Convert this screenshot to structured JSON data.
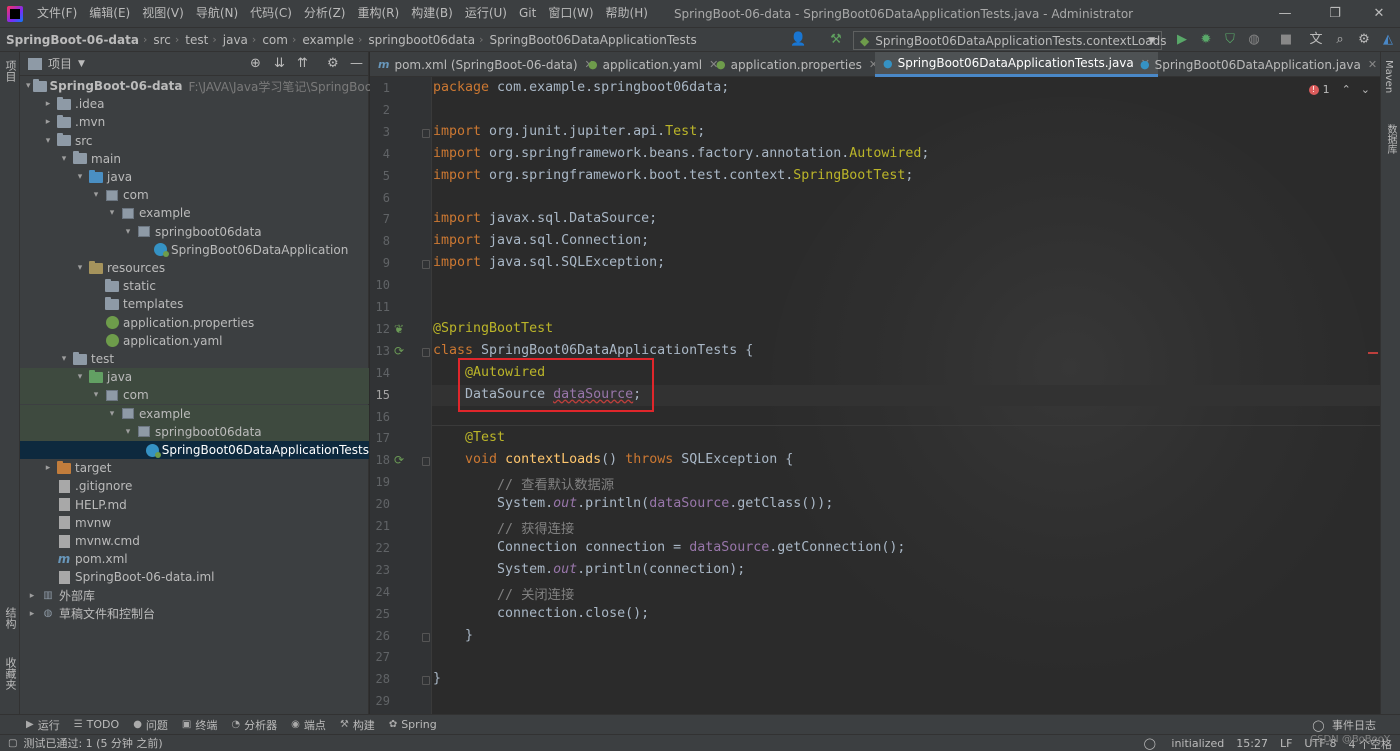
{
  "menubar": {
    "items": [
      "文件(F)",
      "编辑(E)",
      "视图(V)",
      "导航(N)",
      "代码(C)",
      "分析(Z)",
      "重构(R)",
      "构建(B)",
      "运行(U)",
      "Git",
      "窗口(W)",
      "帮助(H)"
    ],
    "title": "SpringBoot-06-data - SpringBoot06DataApplicationTests.java - Administrator"
  },
  "breadcrumb": [
    "SpringBoot-06-data",
    "src",
    "test",
    "java",
    "com",
    "example",
    "springboot06data",
    "SpringBoot06DataApplicationTests"
  ],
  "run_config": "SpringBoot06DataApplicationTests.contextLoads",
  "left_strip": {
    "project": "项目",
    "structure": "结构",
    "favorites": "收藏夹"
  },
  "right_strip": {
    "maven": "Maven",
    "database": "数据库"
  },
  "project_panel": {
    "title": "项目",
    "tree": [
      {
        "label": "SpringBoot-06-data",
        "hint": "F:\\JAVA\\Java学习笔记\\SpringBoot_狂",
        "arrow": "▾",
        "icon": "folder",
        "indent": 0,
        "bold": true
      },
      {
        "label": ".idea",
        "arrow": "▸",
        "icon": "folder",
        "indent": 1
      },
      {
        "label": ".mvn",
        "arrow": "▸",
        "icon": "folder",
        "indent": 1
      },
      {
        "label": "src",
        "arrow": "▾",
        "icon": "folder",
        "indent": 1
      },
      {
        "label": "main",
        "arrow": "▾",
        "icon": "folder",
        "indent": 2
      },
      {
        "label": "java",
        "arrow": "▾",
        "icon": "folder-blue",
        "indent": 3
      },
      {
        "label": "com",
        "arrow": "▾",
        "icon": "package",
        "indent": 4
      },
      {
        "label": "example",
        "arrow": "▾",
        "icon": "package",
        "indent": 5
      },
      {
        "label": "springboot06data",
        "arrow": "▾",
        "icon": "package",
        "indent": 6
      },
      {
        "label": "SpringBoot06DataApplication",
        "arrow": "",
        "icon": "class",
        "indent": 7
      },
      {
        "label": "resources",
        "arrow": "▾",
        "icon": "folder-res",
        "indent": 3
      },
      {
        "label": "static",
        "arrow": "",
        "icon": "folder",
        "indent": 4
      },
      {
        "label": "templates",
        "arrow": "",
        "icon": "folder",
        "indent": 4
      },
      {
        "label": "application.properties",
        "arrow": "",
        "icon": "spring",
        "indent": 4
      },
      {
        "label": "application.yaml",
        "arrow": "",
        "icon": "spring",
        "indent": 4
      },
      {
        "label": "test",
        "arrow": "▾",
        "icon": "folder",
        "indent": 2
      },
      {
        "label": "java",
        "arrow": "▾",
        "icon": "folder-green",
        "indent": 3,
        "green": true
      },
      {
        "label": "com",
        "arrow": "▾",
        "icon": "package",
        "indent": 4,
        "green": true
      },
      {
        "label": "example",
        "arrow": "▾",
        "icon": "package",
        "indent": 5,
        "green": true
      },
      {
        "label": "springboot06data",
        "arrow": "▾",
        "icon": "package",
        "indent": 6,
        "green": true
      },
      {
        "label": "SpringBoot06DataApplicationTests",
        "arrow": "",
        "icon": "class",
        "indent": 7,
        "selected": true
      },
      {
        "label": "target",
        "arrow": "▸",
        "icon": "folder-orange",
        "indent": 1
      },
      {
        "label": ".gitignore",
        "arrow": "",
        "icon": "text",
        "indent": 1
      },
      {
        "label": "HELP.md",
        "arrow": "",
        "icon": "text",
        "indent": 1
      },
      {
        "label": "mvnw",
        "arrow": "",
        "icon": "text",
        "indent": 1
      },
      {
        "label": "mvnw.cmd",
        "arrow": "",
        "icon": "text",
        "indent": 1
      },
      {
        "label": "pom.xml",
        "arrow": "",
        "icon": "m",
        "indent": 1
      },
      {
        "label": "SpringBoot-06-data.iml",
        "arrow": "",
        "icon": "text",
        "indent": 1
      },
      {
        "label": "外部库",
        "arrow": "▸",
        "icon": "lib",
        "indent": 0
      },
      {
        "label": "草稿文件和控制台",
        "arrow": "▸",
        "icon": "scratch",
        "indent": 0
      }
    ]
  },
  "tabs": [
    {
      "label": "pom.xml (SpringBoot-06-data)",
      "icon": "m",
      "active": false
    },
    {
      "label": "application.yaml",
      "icon": "spring",
      "active": false
    },
    {
      "label": "application.properties",
      "icon": "spring",
      "active": false
    },
    {
      "label": "SpringBoot06DataApplicationTests.java",
      "icon": "class",
      "active": true
    },
    {
      "label": "SpringBoot06DataApplication.java",
      "icon": "class",
      "active": false
    }
  ],
  "editor": {
    "current_line": 15,
    "error_count": "1",
    "lines": [
      {
        "n": "1",
        "html": "<span class='kw'>package</span> com.example.springboot06data;"
      },
      {
        "n": "2",
        "html": ""
      },
      {
        "n": "3",
        "html": "<span class='kw'>import</span> org.junit.jupiter.api.<span class='cls'>Test</span>;"
      },
      {
        "n": "4",
        "html": "<span class='kw'>import</span> org.springframework.beans.factory.annotation.<span class='cls'>Autowired</span>;"
      },
      {
        "n": "5",
        "html": "<span class='kw'>import</span> org.springframework.boot.test.context.<span class='cls'>SpringBootTest</span>;"
      },
      {
        "n": "6",
        "html": ""
      },
      {
        "n": "7",
        "html": "<span class='kw'>import</span> javax.sql.DataSource;"
      },
      {
        "n": "8",
        "html": "<span class='kw'>import</span> java.sql.Connection;"
      },
      {
        "n": "9",
        "html": "<span class='kw'>import</span> java.sql.SQLException;"
      },
      {
        "n": "10",
        "html": ""
      },
      {
        "n": "11",
        "html": ""
      },
      {
        "n": "12",
        "html": "<span class='ann'>@SpringBootTest</span>"
      },
      {
        "n": "13",
        "html": "<span class='kw'>class</span> SpringBoot06DataApplicationTests {"
      },
      {
        "n": "14",
        "html": "    <span class='ann'>@Autowired</span>"
      },
      {
        "n": "15",
        "html": "    DataSource <span class='field squiggle'>dataSource</span>;"
      },
      {
        "n": "16",
        "html": ""
      },
      {
        "n": "17",
        "html": "    <span class='ann'>@Test</span>"
      },
      {
        "n": "18",
        "html": "    <span class='kw'>void</span> <span class='fn'>contextLoads</span>() <span class='kw'>throws</span> SQLException {"
      },
      {
        "n": "19",
        "html": "        <span class='cmt'>// 查看默认数据源</span>"
      },
      {
        "n": "20",
        "html": "        System.<span class='fstatic'>out</span>.println(<span class='field'>dataSource</span>.getClass());"
      },
      {
        "n": "21",
        "html": "        <span class='cmt'>// 获得连接</span>"
      },
      {
        "n": "22",
        "html": "        Connection connection = <span class='field'>dataSource</span>.getConnection();"
      },
      {
        "n": "23",
        "html": "        System.<span class='fstatic'>out</span>.println(connection);"
      },
      {
        "n": "24",
        "html": "        <span class='cmt'>// 关闭连接</span>"
      },
      {
        "n": "25",
        "html": "        connection.close();"
      },
      {
        "n": "26",
        "html": "    }"
      },
      {
        "n": "27",
        "html": ""
      },
      {
        "n": "28",
        "html": "}"
      },
      {
        "n": "29",
        "html": ""
      }
    ]
  },
  "bottom_tools": [
    {
      "icon": "▶",
      "label": "运行"
    },
    {
      "icon": "☰",
      "label": "TODO"
    },
    {
      "icon": "●",
      "label": "问题"
    },
    {
      "icon": "▣",
      "label": "终端"
    },
    {
      "icon": "◔",
      "label": "分析器"
    },
    {
      "icon": "◉",
      "label": "端点"
    },
    {
      "icon": "⚒",
      "label": "构建"
    },
    {
      "icon": "✿",
      "label": "Spring"
    }
  ],
  "event_log": "事件日志",
  "status": {
    "message": "测试已通过: 1 (5 分钟 之前)",
    "init": "initialized",
    "position": "15:27",
    "line_sep": "LF",
    "encoding": "UTF-8",
    "indent": "4 个空格"
  },
  "watermark": "CSDN @BoBooY"
}
